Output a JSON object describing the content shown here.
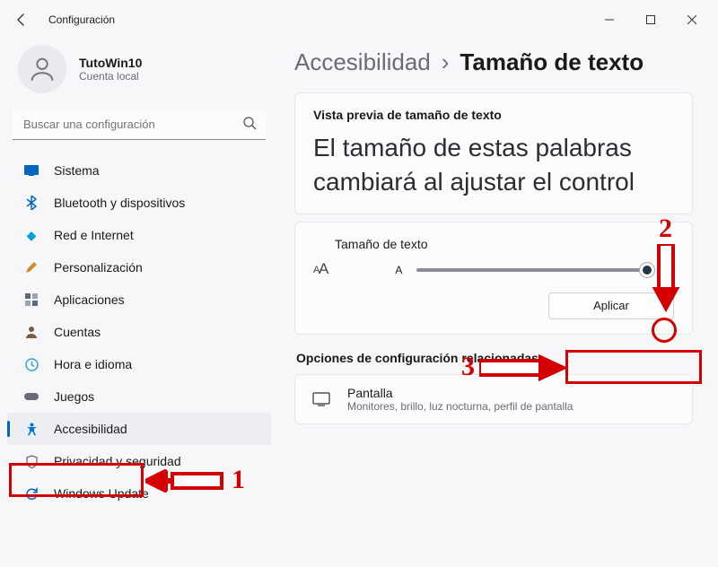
{
  "window": {
    "title": "Configuración"
  },
  "profile": {
    "name": "TutoWin10",
    "sub": "Cuenta local"
  },
  "search": {
    "placeholder": "Buscar una configuración"
  },
  "sidebar": {
    "items": [
      {
        "icon": "monitor-icon",
        "label": "Sistema",
        "color": "#0067c0"
      },
      {
        "icon": "bluetooth-icon",
        "label": "Bluetooth y dispositivos",
        "color": "#0067c0"
      },
      {
        "icon": "wifi-icon",
        "label": "Red e Internet",
        "color": "#00a3d8"
      },
      {
        "icon": "brush-icon",
        "label": "Personalización",
        "color": "#d28a2a"
      },
      {
        "icon": "apps-icon",
        "label": "Aplicaciones",
        "color": "#5b6a7a"
      },
      {
        "icon": "person-icon",
        "label": "Cuentas",
        "color": "#7a5c3f"
      },
      {
        "icon": "clock-icon",
        "label": "Hora e idioma",
        "color": "#2fa5c5"
      },
      {
        "icon": "gamepad-icon",
        "label": "Juegos",
        "color": "#6b6b78"
      },
      {
        "icon": "accessibility-icon",
        "label": "Accesibilidad",
        "color": "#0078d4"
      },
      {
        "icon": "shield-icon",
        "label": "Privacidad y seguridad",
        "color": "#6b6b78"
      },
      {
        "icon": "update-icon",
        "label": "Windows Update",
        "color": "#0067c0"
      }
    ]
  },
  "breadcrumb": {
    "parent": "Accesibilidad",
    "sep": "›",
    "current": "Tamaño de texto"
  },
  "preview": {
    "title": "Vista previa de tamaño de texto",
    "text": "El tamaño de estas palabras cambiará al ajustar el control"
  },
  "sizer": {
    "title": "Tamaño de texto",
    "icon_label": "A",
    "small": "A",
    "big": "A",
    "apply": "Aplicar"
  },
  "related": {
    "heading": "Opciones de configuración relacionadas",
    "display": {
      "title": "Pantalla",
      "sub": "Monitores, brillo, luz nocturna, perfil de pantalla"
    }
  },
  "annotations": {
    "n1": "1",
    "n2": "2",
    "n3": "3"
  }
}
